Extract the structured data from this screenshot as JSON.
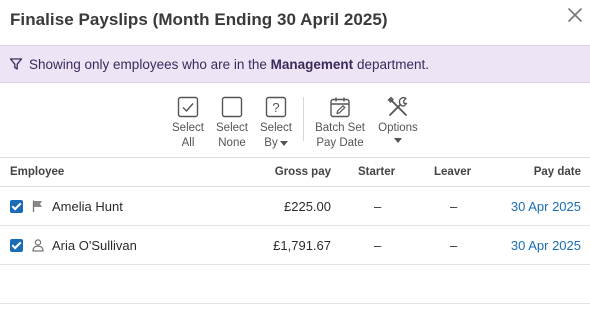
{
  "dialog": {
    "title": "Finalise Payslips (Month Ending 30 April 2025)"
  },
  "filter_banner": {
    "prefix": "Showing only employees who are in the ",
    "department": "Management",
    "suffix": " department."
  },
  "toolbar": {
    "select_all": [
      "Select",
      "All"
    ],
    "select_none": [
      "Select",
      "None"
    ],
    "select_by": [
      "Select",
      "By"
    ],
    "batch_set": [
      "Batch Set",
      "Pay Date"
    ],
    "options": [
      "Options"
    ]
  },
  "table": {
    "columns": {
      "employee": "Employee",
      "gross_pay": "Gross pay",
      "starter": "Starter",
      "leaver": "Leaver",
      "pay_date": "Pay date"
    },
    "rows": [
      {
        "checked": true,
        "icon": "flag-icon",
        "name": "Amelia Hunt",
        "gross_pay": "£225.00",
        "starter": "–",
        "leaver": "–",
        "pay_date": "30 Apr 2025"
      },
      {
        "checked": true,
        "icon": "person-icon",
        "name": "Aria O'Sullivan",
        "gross_pay": "£1,791.67",
        "starter": "–",
        "leaver": "–",
        "pay_date": "30 Apr 2025"
      }
    ]
  },
  "colors": {
    "banner_bg": "#ede5f6",
    "banner_text": "#3b2a5a",
    "accent": "#1a6cb5"
  }
}
